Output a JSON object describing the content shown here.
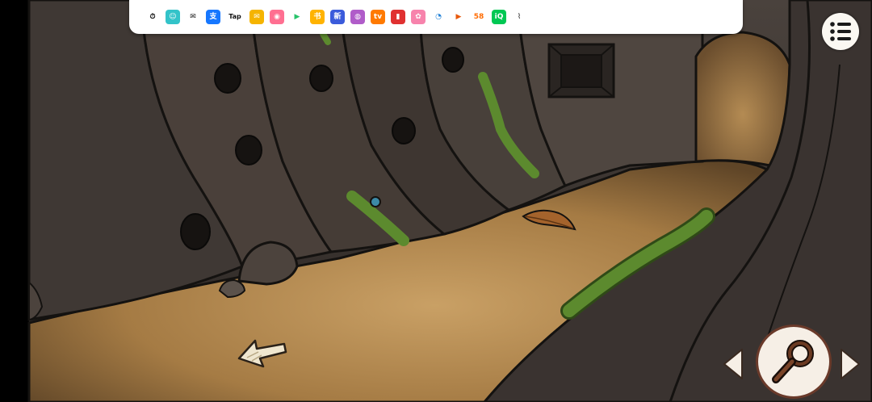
{
  "status_bar": {
    "apps": [
      {
        "name": "stopwatch-icon",
        "label": "⏱",
        "color": "#ffffff",
        "fg": "#111111"
      },
      {
        "name": "qq-kids-icon",
        "label": "☺",
        "color": "#33c3c9",
        "fg": "#ffffff"
      },
      {
        "name": "wechat-icon",
        "label": "✉",
        "color": "#ffffff",
        "fg": "#111111"
      },
      {
        "name": "alipay-icon",
        "label": "支",
        "color": "#1677ff",
        "fg": "#ffffff"
      },
      {
        "name": "taptap-icon",
        "label": "Tap",
        "color": "#ffffff",
        "fg": "#111111"
      },
      {
        "name": "mail-icon",
        "label": "✉",
        "color": "#f5b400",
        "fg": "#ffffff"
      },
      {
        "name": "pink-app-icon",
        "label": "◉",
        "color": "#ff6f91",
        "fg": "#ffffff"
      },
      {
        "name": "play-icon",
        "label": "▶",
        "color": "#ffffff",
        "fg": "#27c36a"
      },
      {
        "name": "reader-app-icon",
        "label": "书",
        "color": "#ffb300",
        "fg": "#ffffff"
      },
      {
        "name": "news-app-icon",
        "label": "新",
        "color": "#3b5bdb",
        "fg": "#ffffff"
      },
      {
        "name": "avatar-app-icon",
        "label": "◍",
        "color": "#b05cc9",
        "fg": "#ffffff"
      },
      {
        "name": "tv-app-icon",
        "label": "tv",
        "color": "#ff7a00",
        "fg": "#ffffff"
      },
      {
        "name": "book-app-icon",
        "label": "▮",
        "color": "#e03131",
        "fg": "#ffffff"
      },
      {
        "name": "gallery-app-icon",
        "label": "✿",
        "color": "#f783ac",
        "fg": "#ffffff"
      },
      {
        "name": "browser-app-icon",
        "label": "◔",
        "color": "#ffffff",
        "fg": "#1c7ed6"
      },
      {
        "name": "video-app-icon",
        "label": "▶",
        "color": "#ffffff",
        "fg": "#e8590c"
      },
      {
        "name": "58-app-icon",
        "label": "58",
        "color": "#ffffff",
        "fg": "#ff6b00"
      },
      {
        "name": "iqiyi-icon",
        "label": "iQ",
        "color": "#00c853",
        "fg": "#ffffff"
      },
      {
        "name": "signal-icon",
        "label": "⌇",
        "color": "#ffffff",
        "fg": "#555555"
      }
    ]
  },
  "game": {
    "menu": {
      "icon": "list-menu-icon"
    },
    "magnifier": {
      "icon": "magnifier-icon"
    },
    "nav_left": {
      "icon": "triangle-left-icon"
    },
    "nav_right": {
      "icon": "triangle-right-icon"
    },
    "back": {
      "icon": "back-arrow-icon"
    }
  },
  "colors": {
    "rock": "#3d3733",
    "sand": "#b88a4a",
    "moss": "#5c8a2e",
    "outline": "#141210",
    "button_bg": "#f6efe6",
    "button_border": "#6a3a2a"
  }
}
